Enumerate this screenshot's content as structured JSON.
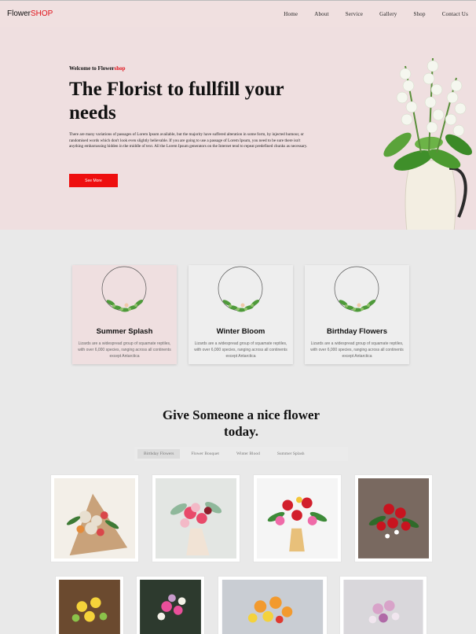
{
  "nav": {
    "logo_main": "Flower",
    "logo_accent": "SHOP",
    "items": [
      "Home",
      "About",
      "Service",
      "Gallery",
      "Shop",
      "Contact Us"
    ]
  },
  "hero": {
    "welcome_main": "Welcome to Flower",
    "welcome_accent": "shop",
    "title": "The Florist to fullfill your needs",
    "body": "There are many variations of passages of Lorem Ipsum available, but the majority have suffered alteration in some form, by injected humour, or randomised words which don't look even slightly believable. If you are going to use a passage of Lorem Ipsum, you need to be sure there isn't anything embarrassing hidden in the middle of text. All the Lorem Ipsum generators on the Internet tend to repeat predefined chunks as necessary.",
    "button_label": "See More"
  },
  "cards": [
    {
      "title": "Summer Splash",
      "body": "Lizards are a widespread group of squamate reptiles, with over 6,000 species, ranging across all continents except Antarctica"
    },
    {
      "title": "Winter Bloom",
      "body": "Lizards are a widespread group of squamate reptiles, with over 6,000 species, ranging across all continents except Antarctica"
    },
    {
      "title": "Birthday Flowers",
      "body": "Lizards are a widespread group of squamate reptiles, with over 6,000 species, ranging across all continents except Antarctica"
    }
  ],
  "gallery": {
    "title": "Give Someone a nice flower today.",
    "tabs": [
      "Birthday Flowers",
      "Flower Bouquet",
      "Winter Blood",
      "Summer Splash"
    ],
    "active_tab": "Birthday Flowers"
  },
  "colors": {
    "accent": "#e0131b",
    "hero_bg": "#efdfe0",
    "page_bg": "#e9e9e9"
  }
}
